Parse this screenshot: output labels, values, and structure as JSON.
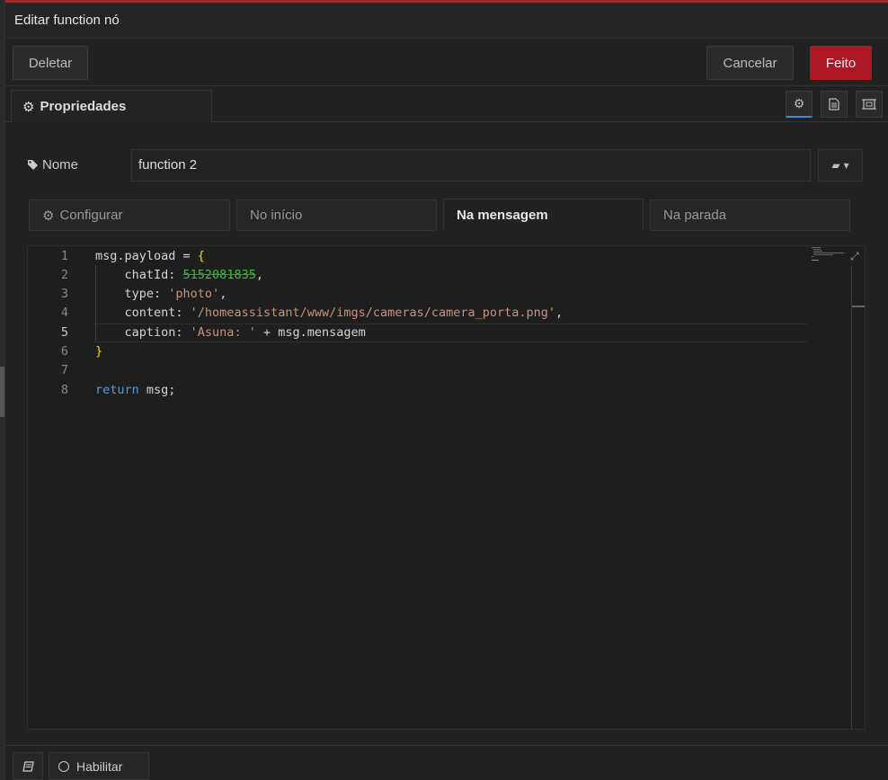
{
  "window": {
    "title": "Editar function nó"
  },
  "toolbar": {
    "delete_label": "Deletar",
    "cancel_label": "Cancelar",
    "done_label": "Feito",
    "done_color": "#ad1625"
  },
  "tabs": {
    "properties_label": "Propriedades",
    "icons": [
      "gear-icon",
      "description-icon",
      "appearance-icon"
    ]
  },
  "name_field": {
    "label": "Nome",
    "value": "function 2",
    "icon": "tag-icon"
  },
  "subtabs": [
    {
      "label": "Configurar",
      "icon": "gear-icon"
    },
    {
      "label": "No início"
    },
    {
      "label": "Na mensagem",
      "active": true
    },
    {
      "label": "Na parada"
    }
  ],
  "editor": {
    "line_numbers": [
      "1",
      "2",
      "3",
      "4",
      "5",
      "6",
      "7",
      "8"
    ],
    "current_line": 5,
    "lines": {
      "l1_a": "msg.payload = ",
      "l1_b": "{",
      "l2_a": "    chatId: ",
      "l2_redacted": "5152081835",
      "l2_c": ",",
      "l3_a": "    type: ",
      "l3_s": "'photo'",
      "l3_c": ",",
      "l4_a": "    content: ",
      "l4_s": "'/homeassistant/www/imgs/cameras/camera_porta.png'",
      "l4_c": ",",
      "l5_a": "    caption: ",
      "l5_s": "'Asuna: '",
      "l5_c": " + msg.mensagem",
      "l6_b": "}",
      "l7": "",
      "l8_k": "return",
      "l8_c": " msg;"
    }
  },
  "footer": {
    "enable_label": "Habilitar"
  }
}
